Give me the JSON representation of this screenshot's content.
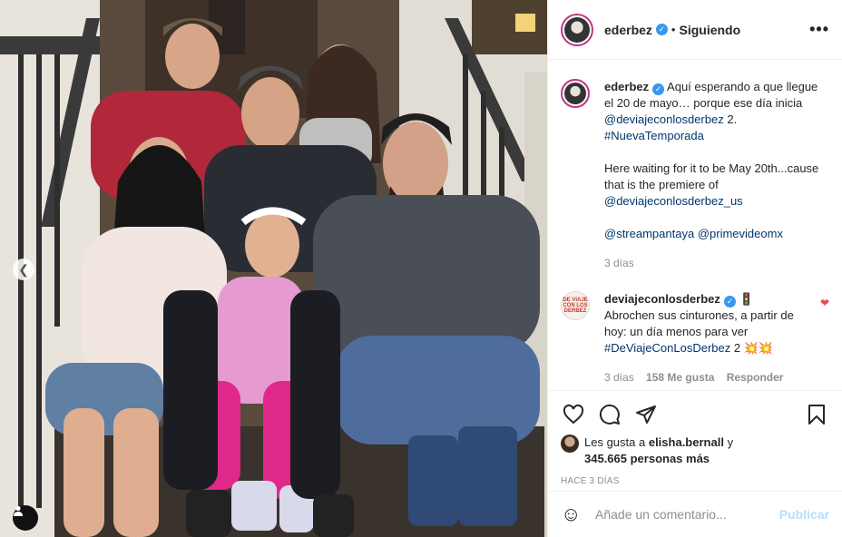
{
  "post": {
    "author": "ederbez",
    "verified": true,
    "follow_status": "Siguiendo",
    "separator": "•",
    "more_icon": "more-options-icon"
  },
  "photo": {
    "prev_icon": "chevron-left-icon",
    "tag_icon": "user-tag-icon"
  },
  "caption": {
    "author": "ederbez",
    "text_1": "Aquí esperando a que llegue el 20 de mayo… porque ese día inicia ",
    "mention_1": "@deviajeconlosderbez",
    "text_1b": " 2.",
    "hashtag_1": "#NuevaTemporada",
    "text_2": "Here waiting for it to be May 20th...cause that is the premiere of ",
    "mention_2": "@deviajeconlosderbez_us",
    "mention_3": "@streampantaya",
    "mention_4": "@primevideomx",
    "time": "3 días"
  },
  "comments": [
    {
      "author": "deviajeconlosderbez",
      "verified": true,
      "emoji_1": "🚦",
      "text": "Abrochen sus cinturones, a partir de hoy: un día menos para ver ",
      "hashtag": "#DeViajeConLosDerbez",
      "text_after": " 2 ",
      "emojis": "💥💥",
      "time": "3 días",
      "likes": "158 Me gusta",
      "reply": "Responder",
      "avatar_text": "DE VIAJE CON LOS DERBEZ"
    }
  ],
  "likes": {
    "prefix": "Les gusta a",
    "user": "elisha.bernall",
    "conj": "y",
    "others": "345.665 personas más"
  },
  "timestamp": "HACE 3 DÍAS",
  "input": {
    "placeholder": "Añade un comentario...",
    "publish": "Publicar"
  },
  "colors": {
    "link": "#00376b",
    "verified": "#3897f0",
    "heart": "#ed4956",
    "publish_disabled": "#b2dffc"
  }
}
